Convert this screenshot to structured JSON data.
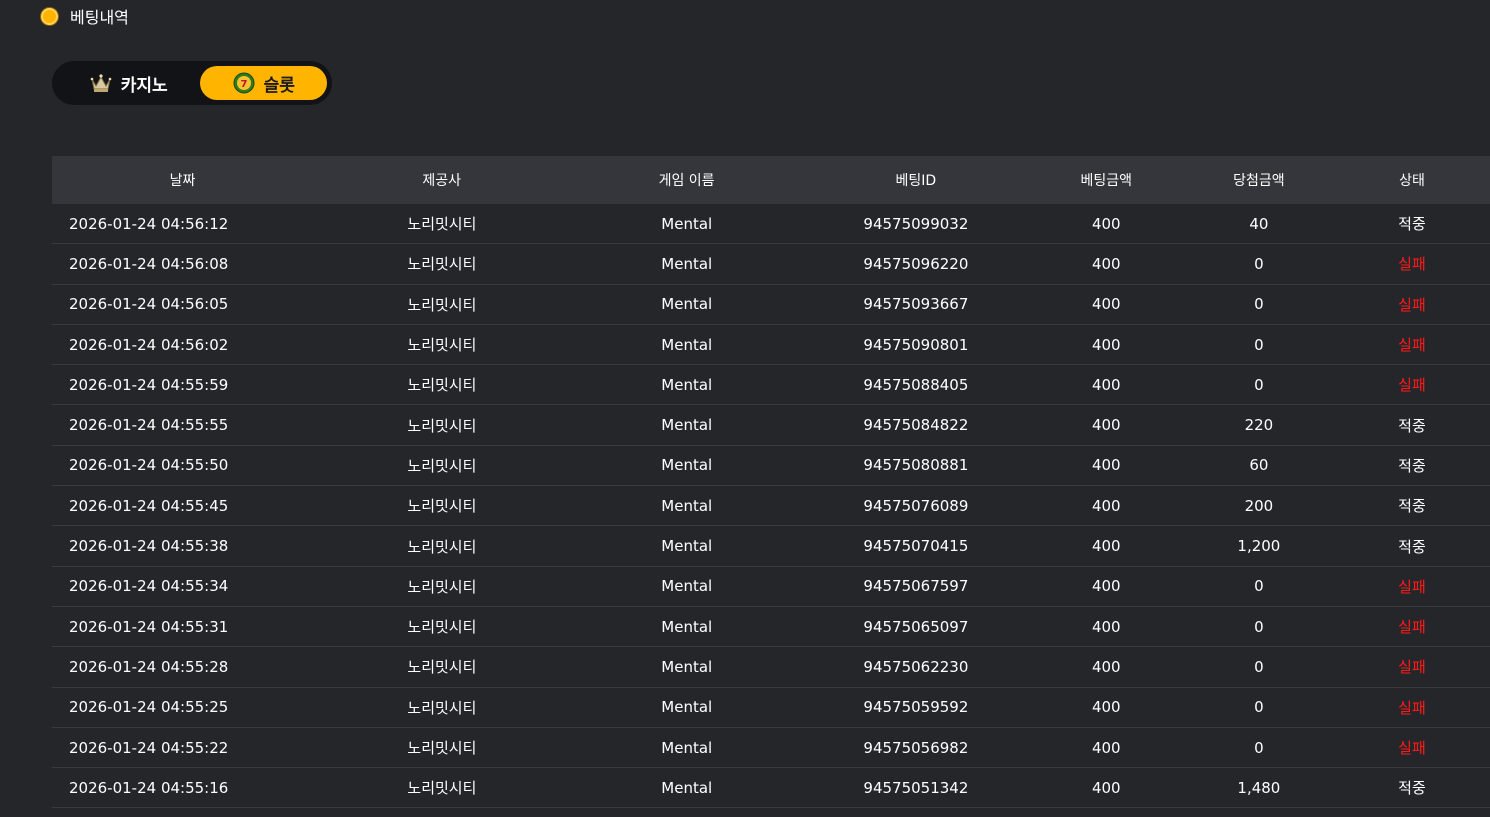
{
  "header": {
    "title": "베팅내역"
  },
  "tabs": [
    {
      "label": "카지노",
      "icon": "casino-crown-icon",
      "active": false
    },
    {
      "label": "슬롯",
      "icon": "slot-seven-icon",
      "active": true
    }
  ],
  "colors": {
    "accent": "#ffb400",
    "lose": "#ff1a1a",
    "background": "#25262a",
    "header_bg": "#34363b"
  },
  "table": {
    "columns": [
      "날짜",
      "제공사",
      "게임 이름",
      "베팅ID",
      "베팅금액",
      "당첨금액",
      "상태"
    ],
    "rows": [
      {
        "date": "2026-01-24 04:56:12",
        "provider": "노리밋시티",
        "game": "Mental",
        "bet_id": "94575099032",
        "bet": "400",
        "win": "40",
        "status": "적중"
      },
      {
        "date": "2026-01-24 04:56:08",
        "provider": "노리밋시티",
        "game": "Mental",
        "bet_id": "94575096220",
        "bet": "400",
        "win": "0",
        "status": "실패"
      },
      {
        "date": "2026-01-24 04:56:05",
        "provider": "노리밋시티",
        "game": "Mental",
        "bet_id": "94575093667",
        "bet": "400",
        "win": "0",
        "status": "실패"
      },
      {
        "date": "2026-01-24 04:56:02",
        "provider": "노리밋시티",
        "game": "Mental",
        "bet_id": "94575090801",
        "bet": "400",
        "win": "0",
        "status": "실패"
      },
      {
        "date": "2026-01-24 04:55:59",
        "provider": "노리밋시티",
        "game": "Mental",
        "bet_id": "94575088405",
        "bet": "400",
        "win": "0",
        "status": "실패"
      },
      {
        "date": "2026-01-24 04:55:55",
        "provider": "노리밋시티",
        "game": "Mental",
        "bet_id": "94575084822",
        "bet": "400",
        "win": "220",
        "status": "적중"
      },
      {
        "date": "2026-01-24 04:55:50",
        "provider": "노리밋시티",
        "game": "Mental",
        "bet_id": "94575080881",
        "bet": "400",
        "win": "60",
        "status": "적중"
      },
      {
        "date": "2026-01-24 04:55:45",
        "provider": "노리밋시티",
        "game": "Mental",
        "bet_id": "94575076089",
        "bet": "400",
        "win": "200",
        "status": "적중"
      },
      {
        "date": "2026-01-24 04:55:38",
        "provider": "노리밋시티",
        "game": "Mental",
        "bet_id": "94575070415",
        "bet": "400",
        "win": "1,200",
        "status": "적중"
      },
      {
        "date": "2026-01-24 04:55:34",
        "provider": "노리밋시티",
        "game": "Mental",
        "bet_id": "94575067597",
        "bet": "400",
        "win": "0",
        "status": "실패"
      },
      {
        "date": "2026-01-24 04:55:31",
        "provider": "노리밋시티",
        "game": "Mental",
        "bet_id": "94575065097",
        "bet": "400",
        "win": "0",
        "status": "실패"
      },
      {
        "date": "2026-01-24 04:55:28",
        "provider": "노리밋시티",
        "game": "Mental",
        "bet_id": "94575062230",
        "bet": "400",
        "win": "0",
        "status": "실패"
      },
      {
        "date": "2026-01-24 04:55:25",
        "provider": "노리밋시티",
        "game": "Mental",
        "bet_id": "94575059592",
        "bet": "400",
        "win": "0",
        "status": "실패"
      },
      {
        "date": "2026-01-24 04:55:22",
        "provider": "노리밋시티",
        "game": "Mental",
        "bet_id": "94575056982",
        "bet": "400",
        "win": "0",
        "status": "실패"
      },
      {
        "date": "2026-01-24 04:55:16",
        "provider": "노리밋시티",
        "game": "Mental",
        "bet_id": "94575051342",
        "bet": "400",
        "win": "1,480",
        "status": "적중"
      }
    ]
  }
}
